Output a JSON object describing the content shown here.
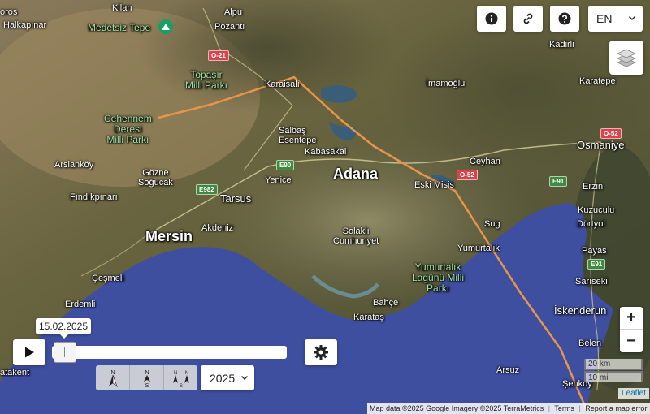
{
  "toolbar": {
    "info_icon": "info-icon",
    "link_icon": "link-icon",
    "help_icon": "help-icon",
    "language": "EN",
    "layers_icon": "layers-icon"
  },
  "map": {
    "places": {
      "kilan": "Kilan",
      "halkapinar": "Halkapınar",
      "medetsiz": "Medetsiz Tepe",
      "alpu": "Alpu",
      "pozanti": "Pozantı",
      "toros": "oros",
      "topasir": "Topaşır\nMilli Parkı",
      "karaisali": "Karaisalı",
      "imamoglu": "İmamoğlu",
      "kadirli": "Kadirli",
      "karatepe": "Karatepe",
      "cehennem": "Cehennem\nDeresi\nMilli Parkı",
      "salbas": "Salbaş\nEsentepe",
      "kabasakal": "Kabasakal",
      "ceyhan": "Ceyhan",
      "osmaniye": "Osmaniye",
      "arslankoy": "Arslanköy",
      "gozne": "Gözne\nSoğucak",
      "yenice": "Yenice",
      "adana": "Adana",
      "eski_misis": "Eski Misis",
      "erzin": "Erzin",
      "findikpinari": "Fındıkpınarı",
      "tarsus": "Tarsus",
      "kuzuculu": "Kuzuculu",
      "dortyol": "Dörtyol",
      "akdeniz": "Akdeniz",
      "mersin": "Mersin",
      "solakli": "Solaklı\nCumhuriyet",
      "sug": "Sug",
      "yumurtalik": "Yumurtalık",
      "payas": "Payas",
      "cesmeli": "Çeşmeli",
      "yumurtalik_lagun": "Yumurtalık\nLagünü Milli\nParkı",
      "sarisaki": "Sarıseki",
      "erdemli": "Erdemli",
      "bahce": "Bahçe",
      "iskenderun": "İskenderun",
      "karatas": "Karataş",
      "belen": "Belen",
      "atakent": "atakent",
      "arsuz": "Arsuz",
      "senkoy": "Şenkoy"
    },
    "roads": {
      "o21": "O-21",
      "o52a": "O-52",
      "o52b": "O-52",
      "e90": "E90",
      "e982": "E982",
      "e91a": "E91",
      "e91b": "E91"
    },
    "track_color": "#e8954a",
    "sea_color": "#3f4fa0"
  },
  "timeline": {
    "play_icon": "play-icon",
    "date": "15.02.2025",
    "settings_icon": "gear-icon",
    "year": "2025",
    "orientation_icons": [
      "north-arrow-icon",
      "north-south-arrow-icon",
      "north-north-arrow-icon"
    ]
  },
  "zoom": {
    "in": "+",
    "out": "−"
  },
  "scale": {
    "km": "20 km",
    "mi": "10 mi"
  },
  "attribution": {
    "leaflet": "Leaflet",
    "data": "Map data ©2025 Google Imagery ©2025 TerraMetrics",
    "terms": "Terms",
    "report": "Report a map error"
  }
}
